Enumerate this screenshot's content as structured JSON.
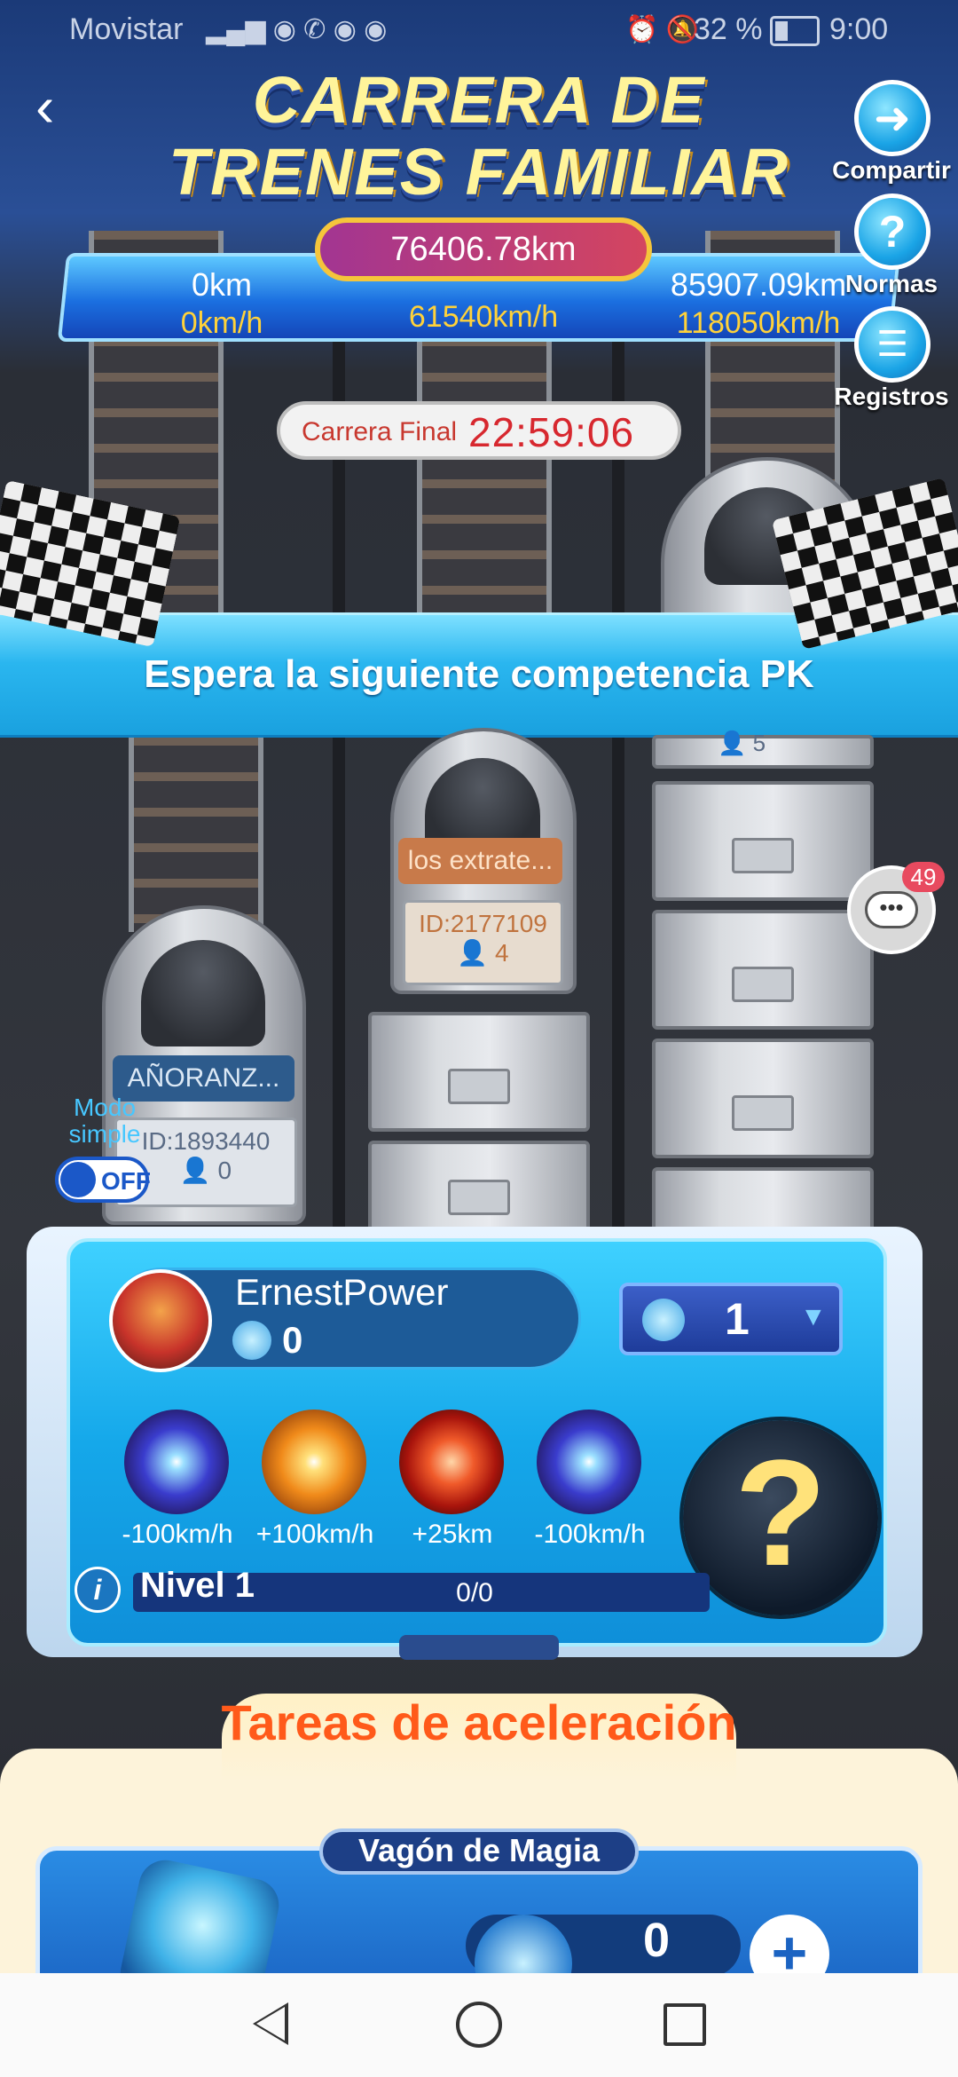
{
  "status_bar": {
    "carrier": "Movistar",
    "battery": "32 %",
    "time": "9:00"
  },
  "header": {
    "title_line1": "CARRERA DE",
    "title_line2": "TRENES FAMILIAR",
    "back_icon": "chevron-left-icon"
  },
  "side_buttons": [
    {
      "label": "Compartir",
      "icon": "share-arrow-icon"
    },
    {
      "label": "Normas",
      "icon": "question-icon"
    },
    {
      "label": "Registros",
      "icon": "notes-icon"
    }
  ],
  "scoreboard": {
    "total_distance": "76406.78km",
    "left_distance": "0km",
    "left_speed": "0km/h",
    "center_speed": "61540km/h",
    "right_distance": "85907.09km",
    "right_speed": "118050km/h"
  },
  "countdown": {
    "label": "Carrera Final",
    "time": "22:59:06"
  },
  "banner": {
    "text": "Espera la siguiente competencia PK"
  },
  "trains": [
    {
      "name": "AÑORANZ...",
      "id": "ID:1893440",
      "members": "0"
    },
    {
      "name": "los extrate...",
      "id": "ID:2177109",
      "members": "4"
    },
    {
      "name": "",
      "id": "",
      "members": "5"
    }
  ],
  "chat": {
    "badge": "49"
  },
  "simple_mode": {
    "label": "Modo simple",
    "toggle": "OFF"
  },
  "player": {
    "name": "ErnestPower",
    "gems": "0",
    "bet_amount": "1",
    "level": "Nivel 1",
    "progress_text": "0/0",
    "skills": [
      {
        "label": "-100km/h",
        "icon": "blue-burst-icon"
      },
      {
        "label": "+100km/h",
        "icon": "orange-burst-icon"
      },
      {
        "label": "+25km",
        "icon": "red-spring-icon"
      },
      {
        "label": "-100km/h",
        "icon": "blue-burst-icon"
      }
    ],
    "mystery_symbol": "?",
    "info_symbol": "i"
  },
  "tasks": {
    "title": "Tareas de aceleración",
    "card_title": "Vagón de Magia",
    "counter": "0"
  },
  "colors": {
    "accent_blue": "#1aa4e6",
    "distance_pill": "#c23a7a",
    "title_yellow": "#fff49a",
    "task_orange": "#ff5a1a",
    "countdown_red": "#d7282f"
  }
}
